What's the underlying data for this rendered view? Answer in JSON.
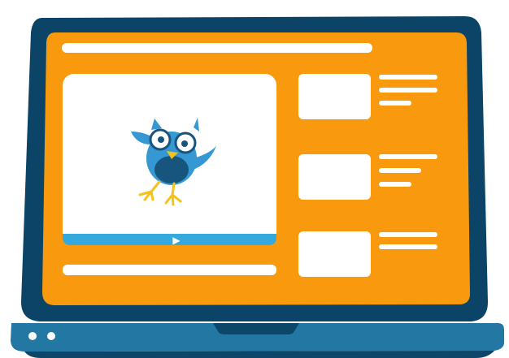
{
  "colors": {
    "frame": "#0b4466",
    "screen": "#f99a0e",
    "placeholder": "#ffffff",
    "progress_bar": "#35a8de",
    "base": "#2277a3",
    "base_dark": "#0d4668",
    "owl_blue": "#3598d3",
    "owl_dark": "#17547e",
    "owl_beak": "#f4c21a"
  },
  "icons": {
    "play": "play-icon",
    "mascot": "owl-mascot"
  },
  "video": {
    "play_glyph": "▶"
  }
}
